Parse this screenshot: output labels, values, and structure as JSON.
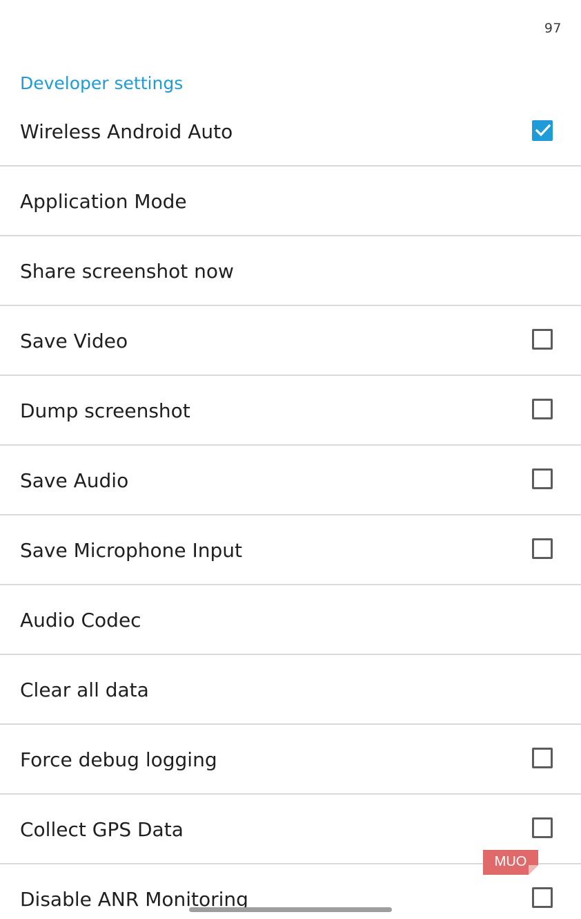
{
  "status": {
    "counter": "97"
  },
  "section": {
    "title": "Developer settings"
  },
  "settings": {
    "items": [
      {
        "label": "Wireless Android Auto",
        "checkbox": true,
        "checked": true
      },
      {
        "label": "Application Mode",
        "checkbox": false
      },
      {
        "label": "Share screenshot now",
        "checkbox": false
      },
      {
        "label": "Save Video",
        "checkbox": true,
        "checked": false
      },
      {
        "label": "Dump screenshot",
        "checkbox": true,
        "checked": false
      },
      {
        "label": "Save Audio",
        "checkbox": true,
        "checked": false
      },
      {
        "label": "Save Microphone Input",
        "checkbox": true,
        "checked": false
      },
      {
        "label": "Audio Codec",
        "checkbox": false
      },
      {
        "label": "Clear all data",
        "checkbox": false
      },
      {
        "label": "Force debug logging",
        "checkbox": true,
        "checked": false
      },
      {
        "label": "Collect GPS Data",
        "checkbox": true,
        "checked": false
      },
      {
        "label": "Disable ANR Monitoring",
        "checkbox": true,
        "checked": false
      }
    ]
  },
  "watermark": {
    "text": "MUO",
    "color": "#e06a6a"
  },
  "colors": {
    "accent": "#1f9bd7",
    "divider": "#d9d9d9",
    "checkbox_border": "#5c5c5c"
  }
}
